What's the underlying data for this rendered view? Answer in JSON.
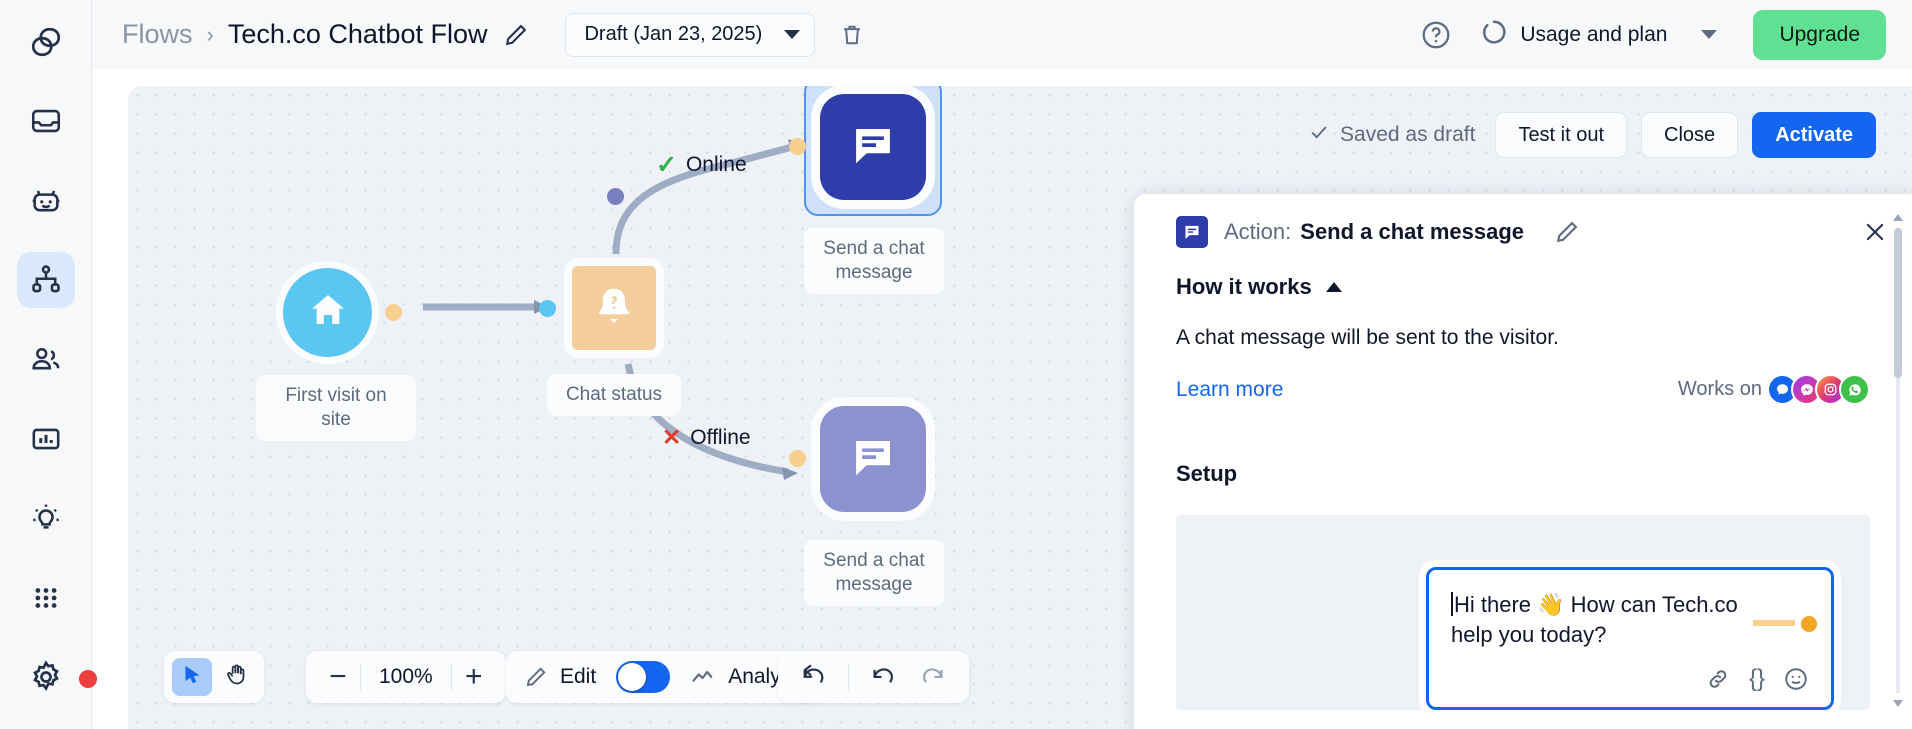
{
  "sidebar": {
    "items": [
      {
        "name": "logo",
        "icon": "overlapping-circles-logo-icon",
        "active": false
      },
      {
        "name": "inbox",
        "icon": "inbox-icon",
        "active": false
      },
      {
        "name": "chatbot",
        "icon": "robot-icon",
        "active": false
      },
      {
        "name": "flows",
        "icon": "flow-chart-icon",
        "active": true
      },
      {
        "name": "contacts",
        "icon": "people-icon",
        "active": false
      },
      {
        "name": "reports",
        "icon": "bar-chart-icon",
        "active": false
      },
      {
        "name": "insights",
        "icon": "lightbulb-icon",
        "active": false
      },
      {
        "name": "apps",
        "icon": "grid-dots-icon",
        "active": false
      },
      {
        "name": "settings",
        "icon": "gear-icon",
        "active": false
      }
    ]
  },
  "header": {
    "breadcrumb_root": "Flows",
    "breadcrumb_separator": "›",
    "title": "Tech.co Chatbot Flow",
    "edit_title_icon": "pencil-icon",
    "version": {
      "label": "Draft (Jan 23, 2025)",
      "caret_icon": "chevron-down-icon"
    },
    "delete_icon": "trash-icon",
    "help_icon": "question-circle-icon",
    "usage": {
      "label": "Usage and plan",
      "icon": "usage-ring-icon",
      "caret_icon": "chevron-down-icon"
    },
    "upgrade_label": "Upgrade",
    "upgrade_color": "#5fe093"
  },
  "canvas_topbar": {
    "saved_text": "Saved as draft",
    "saved_check_icon": "check-icon",
    "test_label": "Test it out",
    "close_label": "Close",
    "activate_label": "Activate",
    "activate_color": "#1466f0"
  },
  "flow": {
    "nodes": [
      {
        "id": "trigger",
        "label": "First visit on site",
        "icon": "home-icon",
        "color": "#5cc6f2"
      },
      {
        "id": "condition",
        "label": "Chat status",
        "icon": "bell-question-icon",
        "color": "#f3ce9c"
      },
      {
        "id": "action-online",
        "label": "Send a chat\nmessage",
        "icon": "chat-message-icon",
        "color": "#2f3dab",
        "selected": true
      },
      {
        "id": "action-offline",
        "label": "Send a chat\nmessage",
        "icon": "chat-message-icon",
        "color": "#8b92cf",
        "selected": false
      }
    ],
    "edges": [
      {
        "label": "Online",
        "marker": "✓",
        "marker_color": "#2fb24b"
      },
      {
        "label": "Offline",
        "marker": "✕",
        "marker_color": "#e03a2f"
      }
    ]
  },
  "panel": {
    "kind_label": "Action:",
    "title": "Send a chat message",
    "icon": "chat-message-icon",
    "edit_icon": "pencil-icon",
    "close_icon": "close-icon",
    "how_it_works": {
      "heading": "How it works",
      "collapse_icon": "chevron-up-icon",
      "body": "A chat message will be sent to the visitor.",
      "learn_more": "Learn more",
      "works_on_label": "Works on",
      "channels": [
        {
          "name": "live-chat",
          "icon": "chat-bubble-icon",
          "color": "#1466f0"
        },
        {
          "name": "messenger",
          "icon": "messenger-icon",
          "color": "#9b3bf5"
        },
        {
          "name": "instagram",
          "icon": "instagram-icon",
          "color": "#e0366f"
        },
        {
          "name": "whatsapp",
          "icon": "whatsapp-icon",
          "color": "#3fc04a"
        }
      ]
    },
    "setup": {
      "heading": "Setup",
      "message_line1": "Hi there 👋 How can Tech.co",
      "message_line2": "help you today?",
      "tools": [
        {
          "name": "insert-link",
          "glyph": "🔗"
        },
        {
          "name": "insert-variable",
          "glyph": "{}"
        },
        {
          "name": "insert-emoji",
          "glyph": "☺"
        }
      ]
    }
  },
  "bottom_toolbar": {
    "pointer_tool_icon": "cursor-arrow-icon",
    "pan_tool_icon": "hand-icon",
    "zoom_out_glyph": "−",
    "zoom_level": "100%",
    "zoom_in_glyph": "+",
    "edit_label": "Edit",
    "edit_icon": "pencil-icon",
    "analyze_label": "Analyze",
    "analyze_icon": "trend-line-icon",
    "toggle_on": true,
    "history": [
      {
        "name": "reset-view",
        "icon": "reset-arrow-icon"
      },
      {
        "name": "undo",
        "icon": "undo-arrow-icon"
      },
      {
        "name": "redo",
        "icon": "redo-arrow-icon"
      }
    ]
  }
}
